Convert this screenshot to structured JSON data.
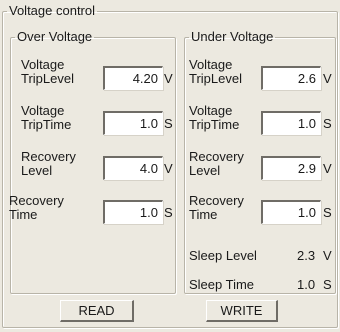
{
  "group_title": "Voltage control",
  "over": {
    "title": "Over Voltage",
    "trip_level": {
      "label1": "Voltage",
      "label2": "TripLevel",
      "value": "4.20",
      "unit": "V"
    },
    "trip_time": {
      "label1": "Voltage",
      "label2": "TripTime",
      "value": "1.0",
      "unit": "S"
    },
    "recovery_level": {
      "label1": "Recovery",
      "label2": "Level",
      "value": "4.0",
      "unit": "V"
    },
    "recovery_time": {
      "label1": "Recovery",
      "label2": "Time",
      "value": "1.0",
      "unit": "S"
    }
  },
  "under": {
    "title": "Under Voltage",
    "trip_level": {
      "label1": "Voltage",
      "label2": "TripLevel",
      "value": "2.6",
      "unit": "V"
    },
    "trip_time": {
      "label1": "Voltage",
      "label2": "TripTime",
      "value": "1.0",
      "unit": "S"
    },
    "recovery_level": {
      "label1": "Recovery",
      "label2": "Level",
      "value": "2.9",
      "unit": "V"
    },
    "recovery_time": {
      "label1": "Recovery",
      "label2": "Time",
      "value": "1.0",
      "unit": "S"
    },
    "sleep_level": {
      "label": "Sleep Level",
      "value": "2.3",
      "unit": "V"
    },
    "sleep_time": {
      "label": "Sleep Time",
      "value": "1.0",
      "unit": "S"
    }
  },
  "buttons": {
    "read": "READ",
    "write": "WRITE"
  }
}
